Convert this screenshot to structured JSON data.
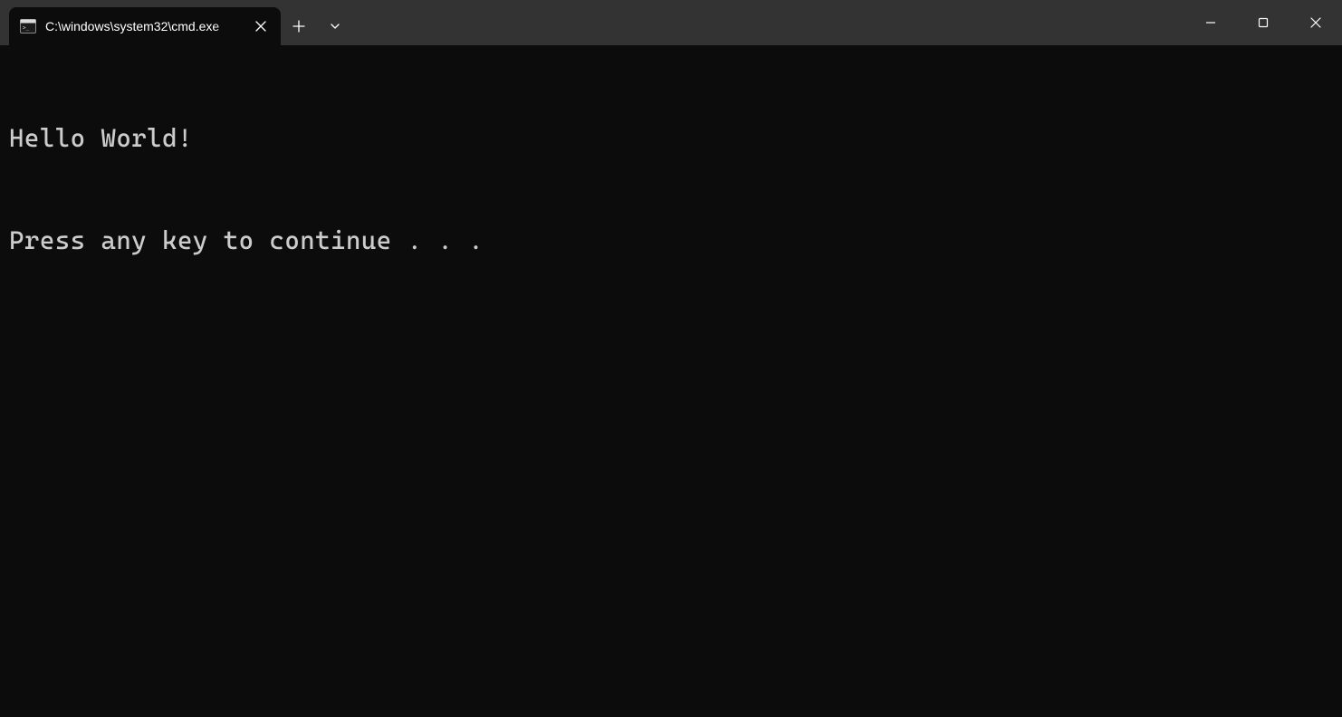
{
  "titlebar": {
    "tab": {
      "title": "C:\\windows\\system32\\cmd.exe",
      "icon": "cmd-icon"
    }
  },
  "terminal": {
    "lines": [
      "Hello World!",
      "Press any key to continue . . ."
    ]
  }
}
